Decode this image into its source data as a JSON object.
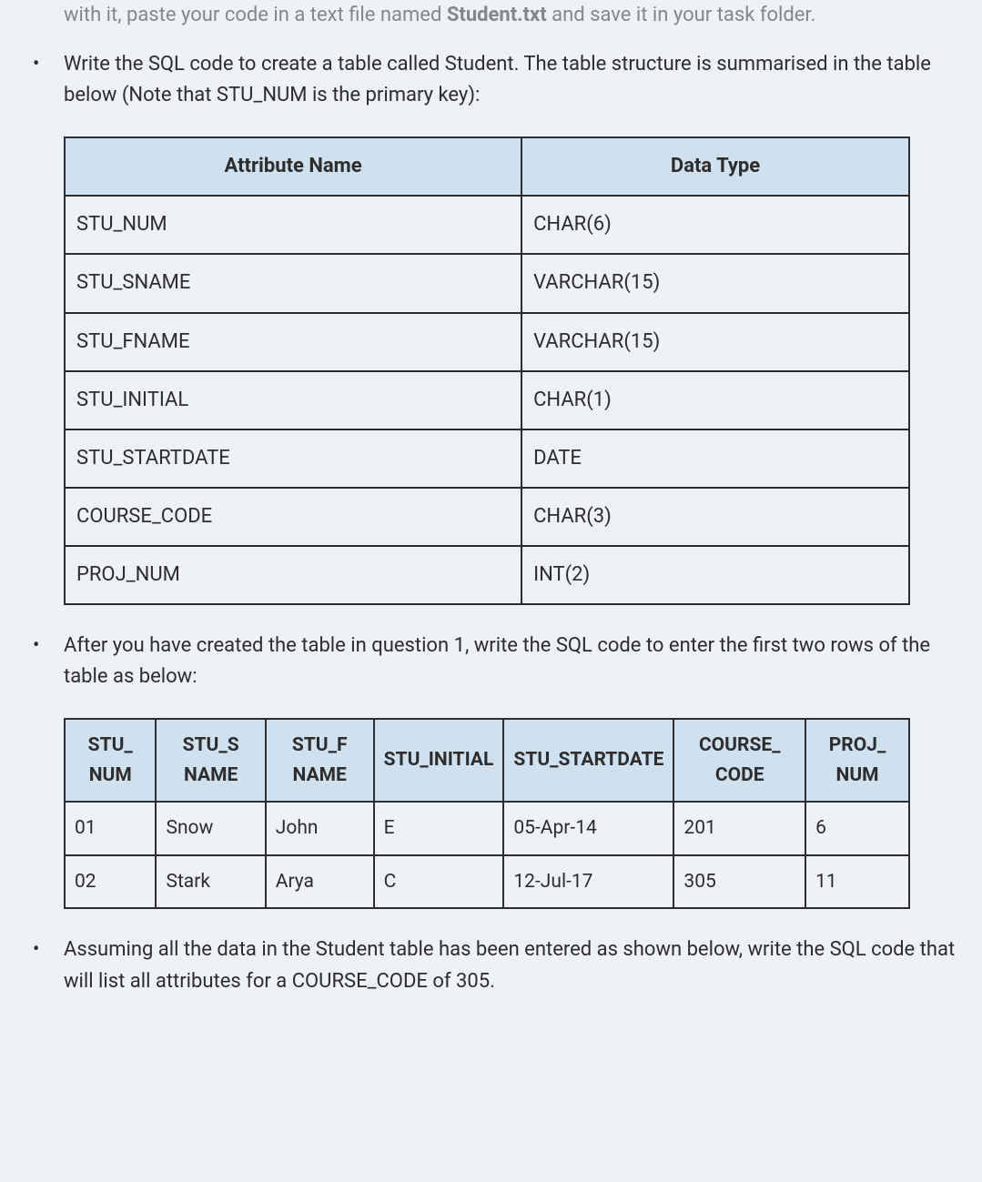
{
  "bullets": {
    "b0_partial_pre": "with it, paste your code in a text file named ",
    "b0_filename": "Student.txt",
    "b0_partial_post": " and save it in your task folder.",
    "b1": "Write the SQL code to create a table called Student. The table structure is summarised in the table below (Note that STU_NUM is the primary key):",
    "b2": "After you have created the table in question 1, write the SQL code to enter the first two rows of the table as below:",
    "b3": "Assuming all the data in the Student table has been entered as shown below, write the SQL code that will list all attributes for a COURSE_CODE of 305."
  },
  "table1": {
    "headers": [
      "Attribute Name",
      "Data Type"
    ],
    "rows": [
      [
        "STU_NUM",
        "CHAR(6)"
      ],
      [
        "STU_SNAME",
        "VARCHAR(15)"
      ],
      [
        "STU_FNAME",
        "VARCHAR(15)"
      ],
      [
        "STU_INITIAL",
        "CHAR(1)"
      ],
      [
        "STU_STARTDATE",
        "DATE"
      ],
      [
        "COURSE_CODE",
        "CHAR(3)"
      ],
      [
        "PROJ_NUM",
        "INT(2)"
      ]
    ]
  },
  "table2": {
    "headers": [
      "STU_ NUM",
      "STU_S NAME",
      "STU_F NAME",
      "STU_INITIAL",
      "STU_STARTDATE",
      "COURSE_ CODE",
      "PROJ_ NUM"
    ],
    "rows": [
      [
        "01",
        "Snow",
        "John",
        "E",
        "05-Apr-14",
        "201",
        "6"
      ],
      [
        "02",
        "Stark",
        "Arya",
        "C",
        "12-Jul-17",
        "305",
        "11"
      ]
    ]
  }
}
